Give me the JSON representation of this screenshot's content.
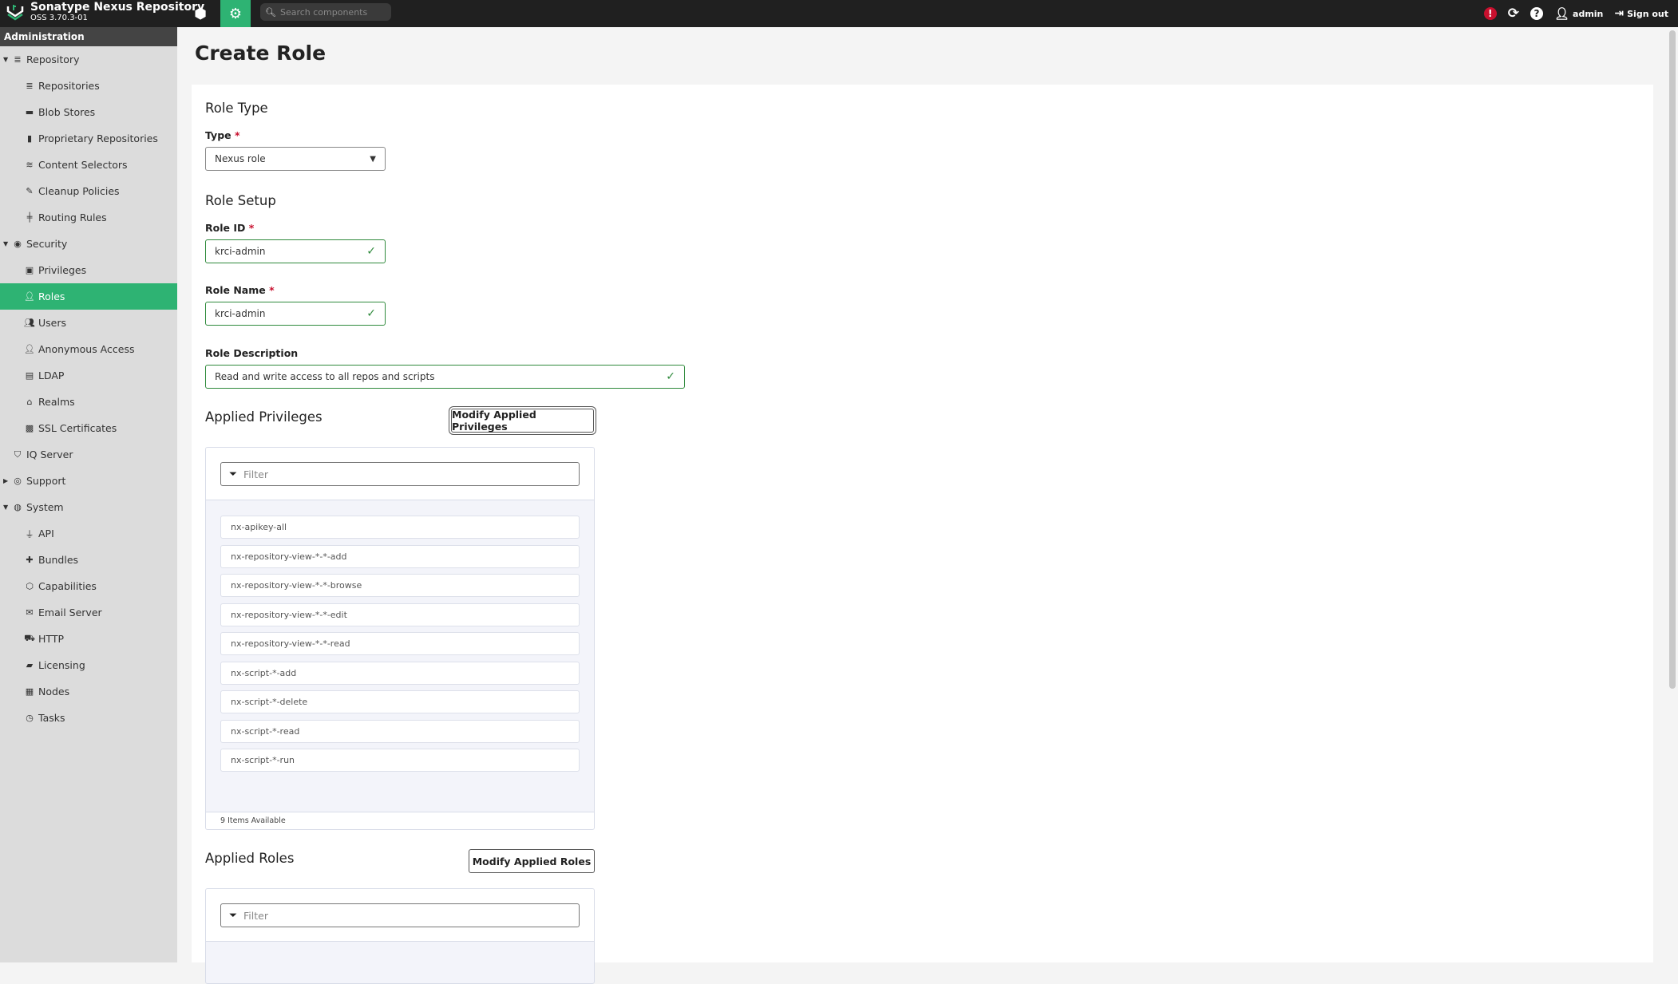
{
  "header": {
    "app_name": "Sonatype Nexus Repository",
    "version": "OSS 3.70.3-01",
    "search_placeholder": "Search components",
    "user": "admin",
    "sign_out": "Sign out",
    "alert_icon": "!"
  },
  "sidebar": {
    "title": "Administration",
    "items": [
      {
        "label": "Repository",
        "icon": "database-icon",
        "level": 0,
        "expanded": true
      },
      {
        "label": "Repositories",
        "icon": "database-icon",
        "level": 1
      },
      {
        "label": "Blob Stores",
        "icon": "hdd-icon",
        "level": 1
      },
      {
        "label": "Proprietary Repositories",
        "icon": "door-icon",
        "level": 1
      },
      {
        "label": "Content Selectors",
        "icon": "layers-icon",
        "level": 1
      },
      {
        "label": "Cleanup Policies",
        "icon": "broom-icon",
        "level": 1
      },
      {
        "label": "Routing Rules",
        "icon": "signpost-icon",
        "level": 1
      },
      {
        "label": "Security",
        "icon": "eye-icon",
        "level": 0,
        "expanded": true
      },
      {
        "label": "Privileges",
        "icon": "id-badge-icon",
        "level": 1
      },
      {
        "label": "Roles",
        "icon": "user-tag-icon",
        "level": 1,
        "active": true
      },
      {
        "label": "Users",
        "icon": "users-icon",
        "level": 1
      },
      {
        "label": "Anonymous Access",
        "icon": "user-icon",
        "level": 1
      },
      {
        "label": "LDAP",
        "icon": "book-icon",
        "level": 1
      },
      {
        "label": "Realms",
        "icon": "archway-icon",
        "level": 1
      },
      {
        "label": "SSL Certificates",
        "icon": "id-card-icon",
        "level": 1
      },
      {
        "label": "IQ Server",
        "icon": "shield-icon",
        "level": 0
      },
      {
        "label": "Support",
        "icon": "lifebuoy-icon",
        "level": 0,
        "expanded": false
      },
      {
        "label": "System",
        "icon": "globe-icon",
        "level": 0,
        "expanded": true
      },
      {
        "label": "API",
        "icon": "plug-icon",
        "level": 1
      },
      {
        "label": "Bundles",
        "icon": "puzzle-icon",
        "level": 1
      },
      {
        "label": "Capabilities",
        "icon": "cube-icon",
        "level": 1
      },
      {
        "label": "Email Server",
        "icon": "envelope-icon",
        "level": 1
      },
      {
        "label": "HTTP",
        "icon": "truck-icon",
        "level": 1
      },
      {
        "label": "Licensing",
        "icon": "wallet-icon",
        "level": 1
      },
      {
        "label": "Nodes",
        "icon": "server-icon",
        "level": 1
      },
      {
        "label": "Tasks",
        "icon": "clock-icon",
        "level": 1
      }
    ]
  },
  "page": {
    "title": "Create Role",
    "role_type": {
      "heading": "Role Type",
      "type_label": "Type",
      "type_value": "Nexus role"
    },
    "role_setup": {
      "heading": "Role Setup",
      "id_label": "Role ID",
      "id_value": "krci-admin",
      "name_label": "Role Name",
      "name_value": "krci-admin",
      "desc_label": "Role Description",
      "desc_value": "Read and write access to all repos and scripts"
    },
    "required_mark": "*",
    "privileges": {
      "heading": "Applied Privileges",
      "modify_button": "Modify Applied Privileges",
      "filter_placeholder": "Filter",
      "items": [
        "nx-apikey-all",
        "nx-repository-view-*-*-add",
        "nx-repository-view-*-*-browse",
        "nx-repository-view-*-*-edit",
        "nx-repository-view-*-*-read",
        "nx-script-*-add",
        "nx-script-*-delete",
        "nx-script-*-read",
        "nx-script-*-run"
      ],
      "footer": "9 Items Available"
    },
    "roles": {
      "heading": "Applied Roles",
      "modify_button": "Modify Applied Roles",
      "filter_placeholder": "Filter"
    }
  },
  "colors": {
    "accent": "#2eb373",
    "topbar": "#202020",
    "alert": "#c8102e",
    "valid": "#2f8a3c"
  }
}
